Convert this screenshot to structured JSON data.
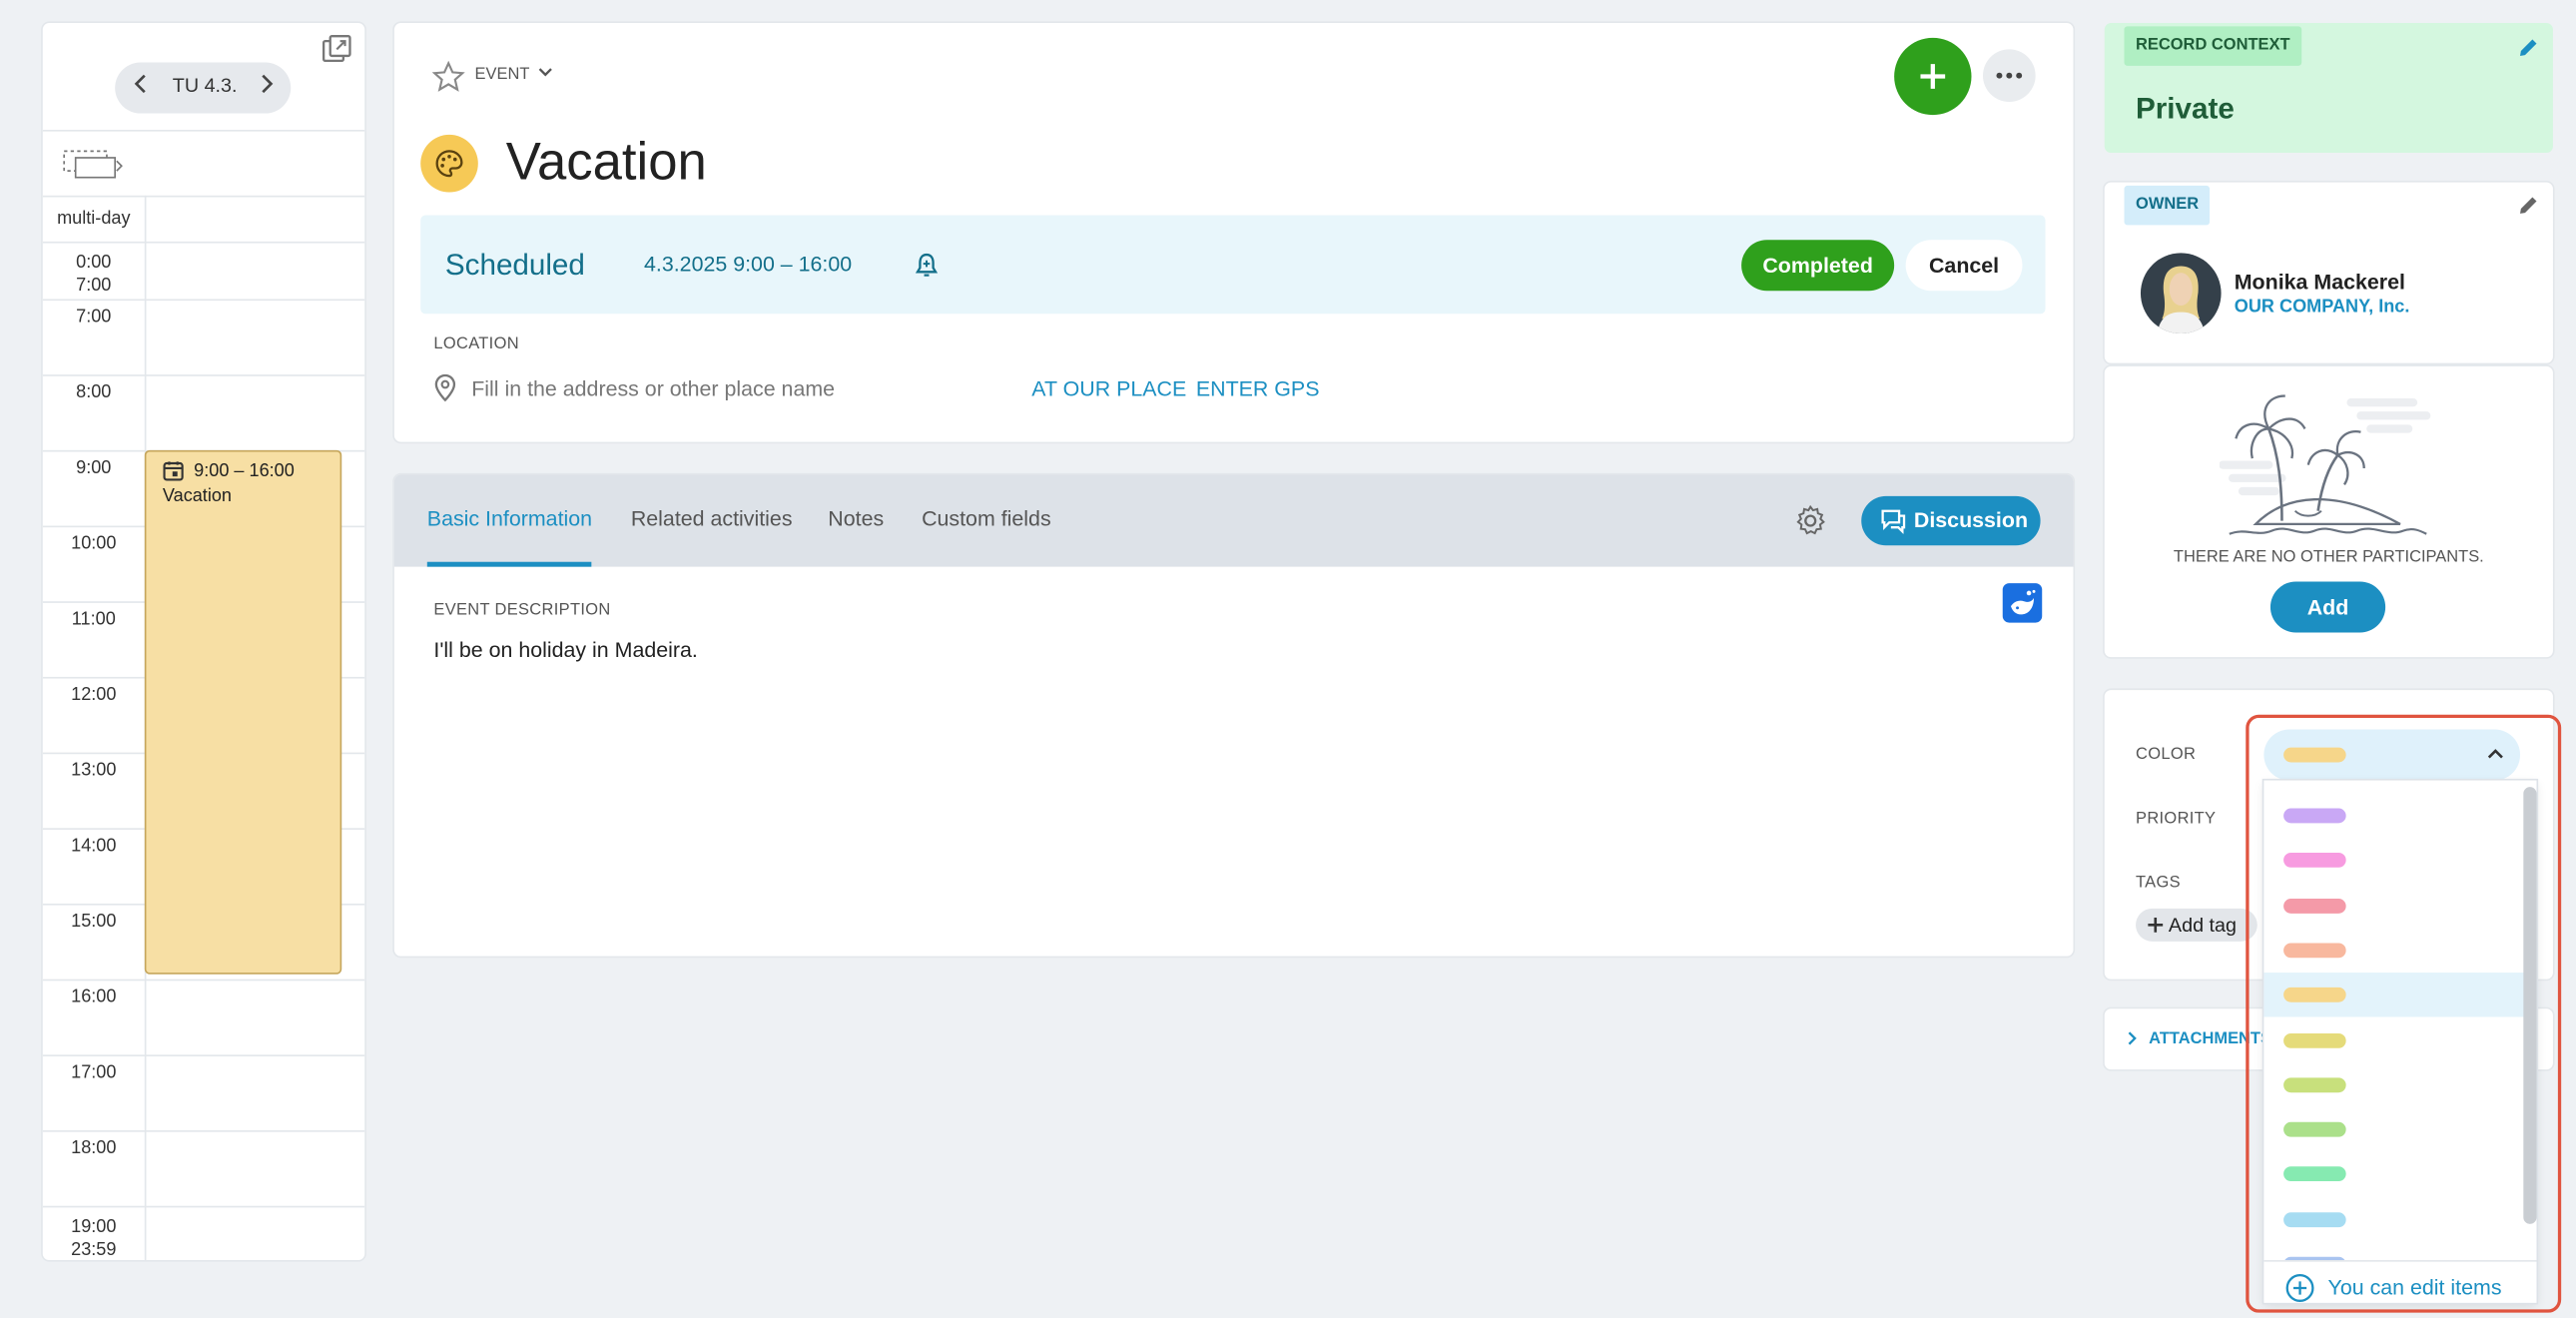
{
  "calendar": {
    "day_label": "TU 4.3.",
    "multiday_label": "multi-day",
    "hours": [
      {
        "label": "0:00",
        "label2": "7:00"
      },
      {
        "label": "7:00"
      },
      {
        "label": "8:00"
      },
      {
        "label": "9:00"
      },
      {
        "label": "10:00"
      },
      {
        "label": "11:00"
      },
      {
        "label": "12:00"
      },
      {
        "label": "13:00"
      },
      {
        "label": "14:00"
      },
      {
        "label": "15:00"
      },
      {
        "label": "16:00"
      },
      {
        "label": "17:00"
      },
      {
        "label": "18:00"
      },
      {
        "label": "19:00",
        "label2": "23:59"
      }
    ],
    "event": {
      "time": "9:00 – 16:00",
      "title": "Vacation"
    }
  },
  "record": {
    "type_label": "EVENT",
    "title": "Vacation",
    "status": "Scheduled",
    "datetime": "4.3.2025 9:00 – 16:00",
    "completed_label": "Completed",
    "cancel_label": "Cancel",
    "location_label": "LOCATION",
    "location_placeholder": "Fill in the address or other place name",
    "at_our_place": "AT OUR PLACE",
    "enter_gps": "ENTER GPS"
  },
  "tabs": [
    {
      "label": "Basic Information",
      "active": true
    },
    {
      "label": "Related activities"
    },
    {
      "label": "Notes"
    },
    {
      "label": "Custom fields"
    }
  ],
  "discussion_label": "Discussion",
  "description": {
    "label": "EVENT DESCRIPTION",
    "text": "I'll be on holiday in Madeira."
  },
  "context": {
    "label": "RECORD CONTEXT",
    "value": "Private"
  },
  "owner": {
    "label": "OWNER",
    "name": "Monika Mackerel",
    "company": "OUR COMPANY, Inc."
  },
  "participants": {
    "empty_text": "THERE ARE NO OTHER PARTICIPANTS.",
    "add_label": "Add"
  },
  "fields": {
    "color_label": "COLOR",
    "priority_label": "PRIORITY",
    "tags_label": "TAGS",
    "add_tag_label": "Add tag",
    "selected_color": "#f6d68a"
  },
  "attachments_label": "ATTACHMENTS",
  "color_options": [
    {
      "color": "#c9a8f5"
    },
    {
      "color": "#f79be0"
    },
    {
      "color": "#f49aa8"
    },
    {
      "color": "#f8b89e"
    },
    {
      "color": "#f6d68a",
      "selected": true
    },
    {
      "color": "#e5db7a"
    },
    {
      "color": "#c8e07c"
    },
    {
      "color": "#abe08a"
    },
    {
      "color": "#86eab1"
    },
    {
      "color": "#a6dcf2"
    },
    {
      "color": "#a9c4f0"
    }
  ],
  "dropdown_footer": "You can edit items here",
  "colors": {
    "accent": "#1c8fc2",
    "green": "#2fa01c",
    "teal_text": "#136f8a"
  }
}
